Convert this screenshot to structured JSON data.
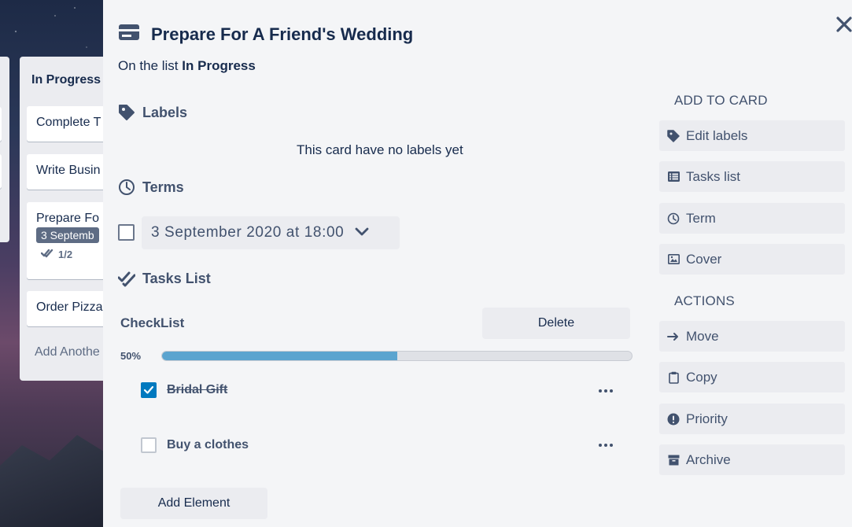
{
  "board": {
    "list_title": "In Progress",
    "cards": [
      {
        "title": "Complete T"
      },
      {
        "title": "Write Busin"
      },
      {
        "title": "Prepare Fo",
        "badge": "3 Septemb",
        "meta": "1/2"
      },
      {
        "title": "Order Pizza"
      }
    ],
    "add_another": "Add Anothe"
  },
  "modal": {
    "title": "Prepare For A Friend's Wedding",
    "subtitle_prefix": "On the list",
    "subtitle_list": "In Progress",
    "labels": {
      "heading": "Labels",
      "empty_text": "This card have no labels yet"
    },
    "terms": {
      "heading": "Terms",
      "date": "3 September 2020 at 18:00",
      "checked": false
    },
    "tasks": {
      "heading": "Tasks List",
      "checklist_title": "CheckList",
      "delete_label": "Delete",
      "progress_label": "50%",
      "progress": 0.5,
      "items": [
        {
          "label": "Bridal Gift",
          "checked": true
        },
        {
          "label": "Buy a clothes",
          "checked": false
        }
      ],
      "add_label": "Add Element"
    },
    "sidebar": {
      "add_heading": "ADD TO CARD",
      "add_items": [
        {
          "label": "Edit labels",
          "icon": "tag-icon"
        },
        {
          "label": "Tasks list",
          "icon": "list-icon"
        },
        {
          "label": "Term",
          "icon": "clock-icon"
        },
        {
          "label": "Cover",
          "icon": "image-icon"
        }
      ],
      "actions_heading": "ACTIONS",
      "action_items": [
        {
          "label": "Move",
          "icon": "arrow-right-icon"
        },
        {
          "label": "Copy",
          "icon": "clipboard-icon"
        },
        {
          "label": "Priority",
          "icon": "exclamation-circle-icon"
        },
        {
          "label": "Archive",
          "icon": "archive-box-icon"
        }
      ]
    }
  },
  "colors": {
    "accent": "#0079bf",
    "progress": "#5ba4cf",
    "text_dark": "#172b4d",
    "text_muted": "#42526e",
    "button_bg": "#ebecf0",
    "modal_bg": "#f4f5f7"
  }
}
